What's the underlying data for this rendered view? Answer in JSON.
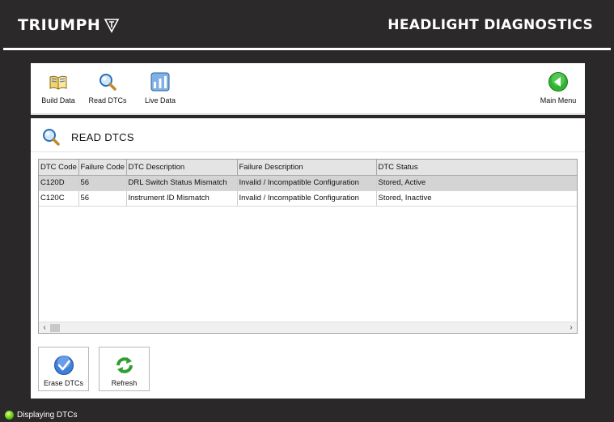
{
  "header": {
    "brand": "TRIUMPH",
    "title": "HEADLIGHT DIAGNOSTICS"
  },
  "toolbar": {
    "items": [
      {
        "label": "Build Data",
        "icon": "book-icon"
      },
      {
        "label": "Read DTCs",
        "icon": "magnifier-icon"
      },
      {
        "label": "Live Data",
        "icon": "live-data-icon"
      }
    ],
    "main_menu_label": "Main Menu"
  },
  "panel": {
    "title": "READ DTCS"
  },
  "table": {
    "columns": [
      "DTC Code",
      "Failure Code",
      "DTC Description",
      "Failure Description",
      "DTC Status"
    ],
    "rows": [
      [
        "C120D",
        "56",
        "DRL Switch Status Mismatch",
        "Invalid / Incompatible Configuration",
        "Stored, Active"
      ],
      [
        "C120C",
        "56",
        "Instrument ID Mismatch",
        "Invalid / Incompatible Configuration",
        "Stored, Inactive"
      ]
    ]
  },
  "actions": {
    "erase_label": "Erase DTCs",
    "refresh_label": "Refresh"
  },
  "status": {
    "text": "Displaying DTCs",
    "indicator_color": "#59c20f"
  },
  "colors": {
    "background": "#2a2828",
    "selected_row": "#d4d4d4",
    "main_menu_green": "#2fb52f"
  }
}
